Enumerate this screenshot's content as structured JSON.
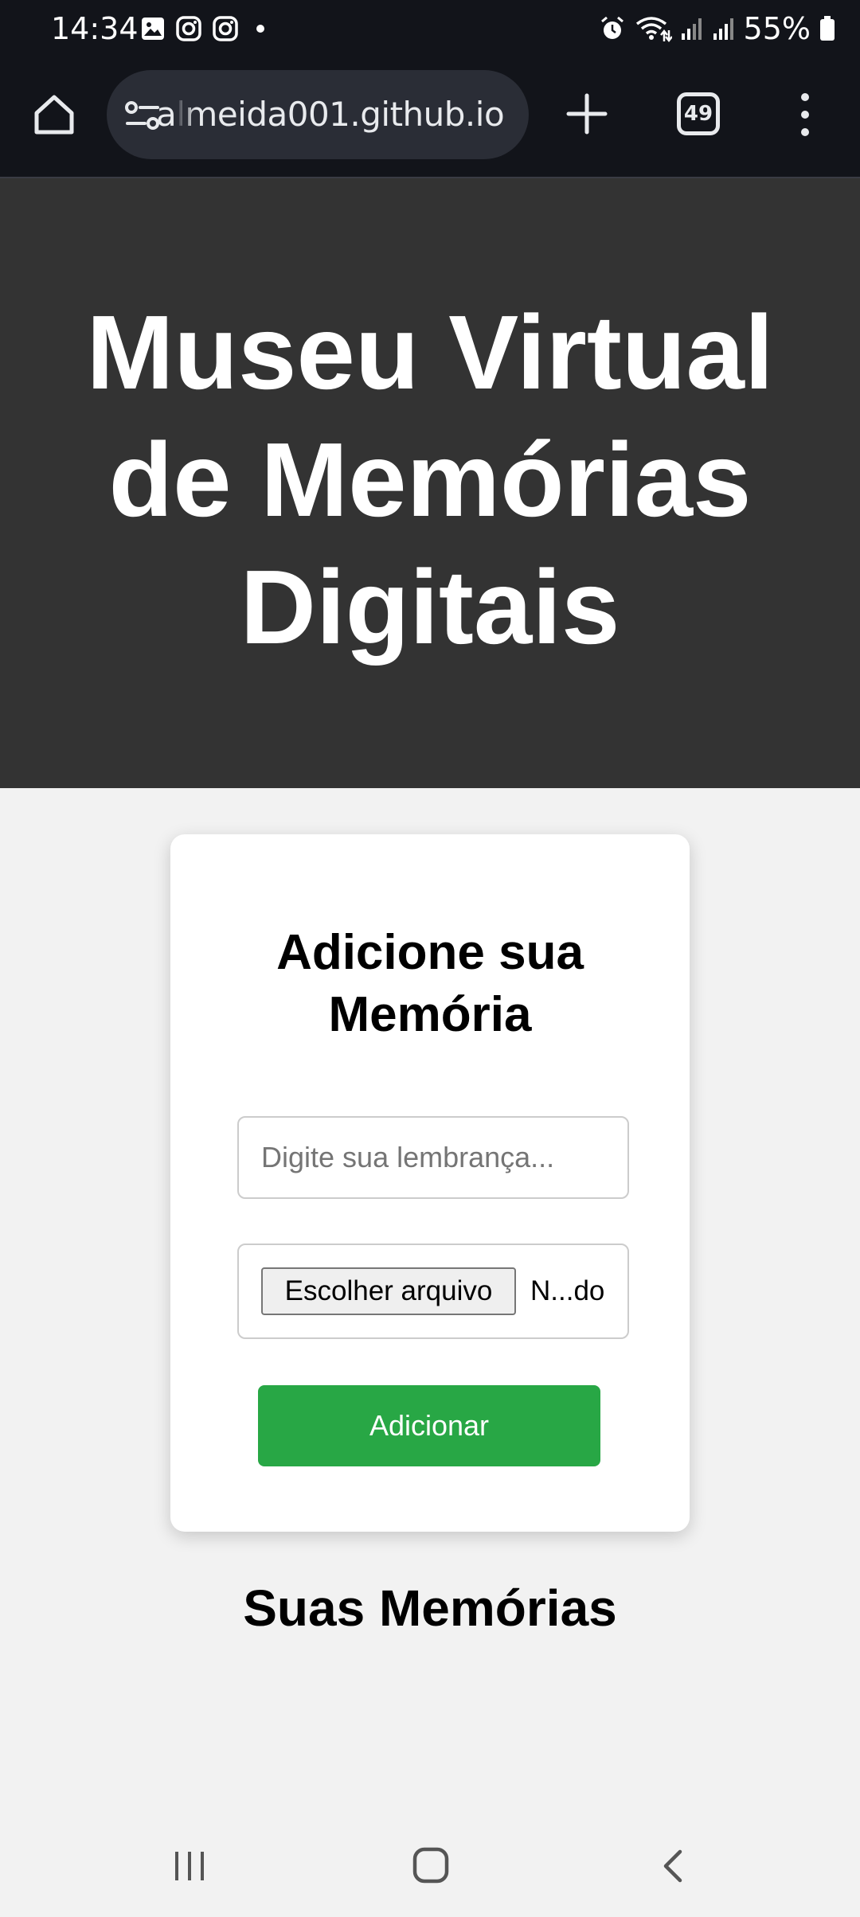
{
  "status_bar": {
    "time": "14:34",
    "battery": "55%",
    "left_icons": [
      "image-icon",
      "instagram-icon",
      "instagram-icon",
      "dot-icon"
    ],
    "right_icons": [
      "alarm-icon",
      "wifi-icon",
      "signal-icon",
      "signal-icon",
      "battery-icon"
    ]
  },
  "browser": {
    "url": "almeida001.github.io",
    "tab_count": "49",
    "icons": [
      "home-icon",
      "tune-icon",
      "plus-icon",
      "tabs-icon",
      "menu-icon"
    ]
  },
  "page": {
    "title": "Museu Virtual de Memórias Digitais",
    "form": {
      "heading": "Adicione sua Memória",
      "memory_placeholder": "Digite sua lembrança...",
      "memory_value": "",
      "file_button_label": "Escolher arquivo",
      "file_status": "N...do",
      "submit_label": "Adicionar"
    },
    "memories_heading": "Suas Memórias"
  },
  "colors": {
    "header_bg": "#333333",
    "page_bg": "#f2f2f2",
    "submit_bg": "#28a745",
    "browser_bg": "#12141a"
  },
  "nav_bar": {
    "icons": [
      "recents-icon",
      "home-icon",
      "back-icon"
    ]
  }
}
